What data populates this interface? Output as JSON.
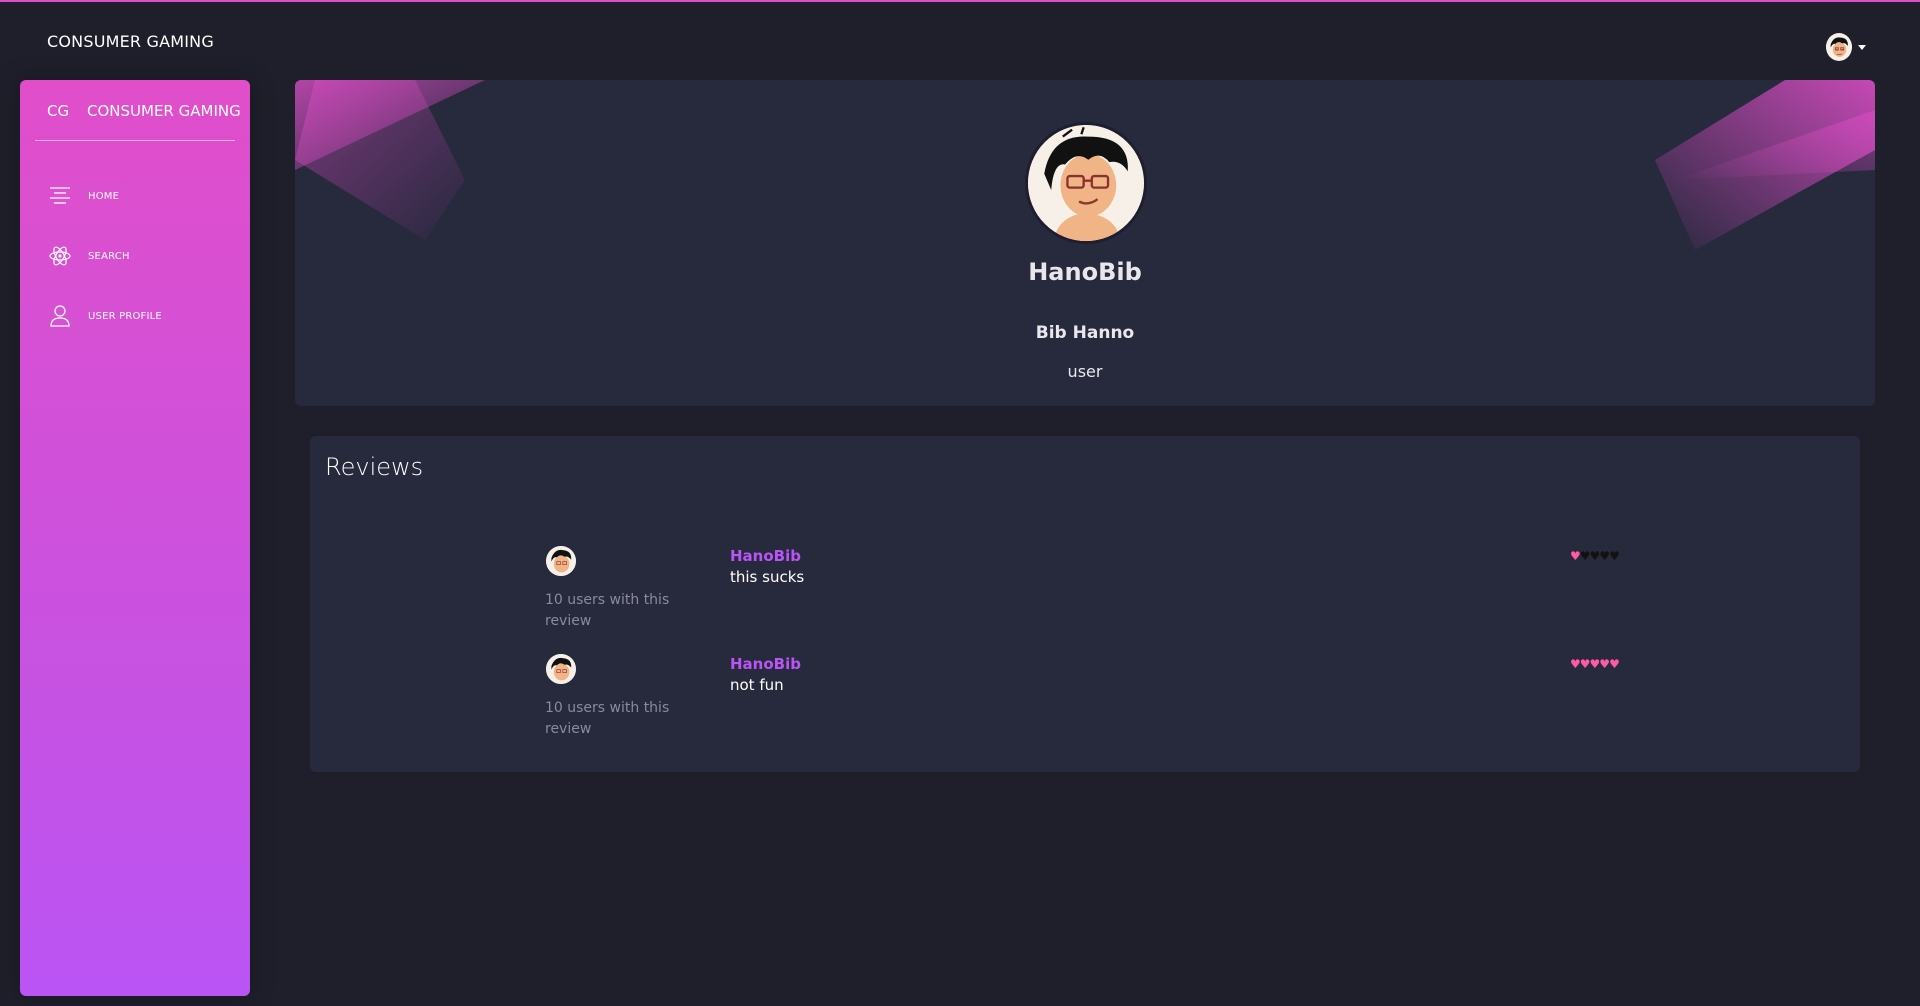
{
  "topbar": {
    "brand": "CONSUMER GAMING"
  },
  "sidebar": {
    "logo_abbr": "CG",
    "logo_name": "CONSUMER GAMING",
    "items": [
      {
        "label": "HOME",
        "icon": "align-center-icon"
      },
      {
        "label": "SEARCH",
        "icon": "atom-icon"
      },
      {
        "label": "USER PROFILE",
        "icon": "user-icon"
      }
    ]
  },
  "profile": {
    "username": "HanoBib",
    "full_name": "Bib Hanno",
    "role": "user"
  },
  "reviews": {
    "title": "Reviews",
    "items": [
      {
        "user": "HanoBib",
        "text": "this sucks",
        "count_text": "10 users with this review",
        "rating": 1,
        "max": 5
      },
      {
        "user": "HanoBib",
        "text": "not fun",
        "count_text": "10 users with this review",
        "rating": 5,
        "max": 5
      }
    ]
  },
  "colors": {
    "accent_pink": "#e14eca",
    "accent_purple": "#ba54f5",
    "heart_on": "#ff5aa5",
    "card_bg": "#27293d",
    "page_bg": "#1f1f2b"
  }
}
